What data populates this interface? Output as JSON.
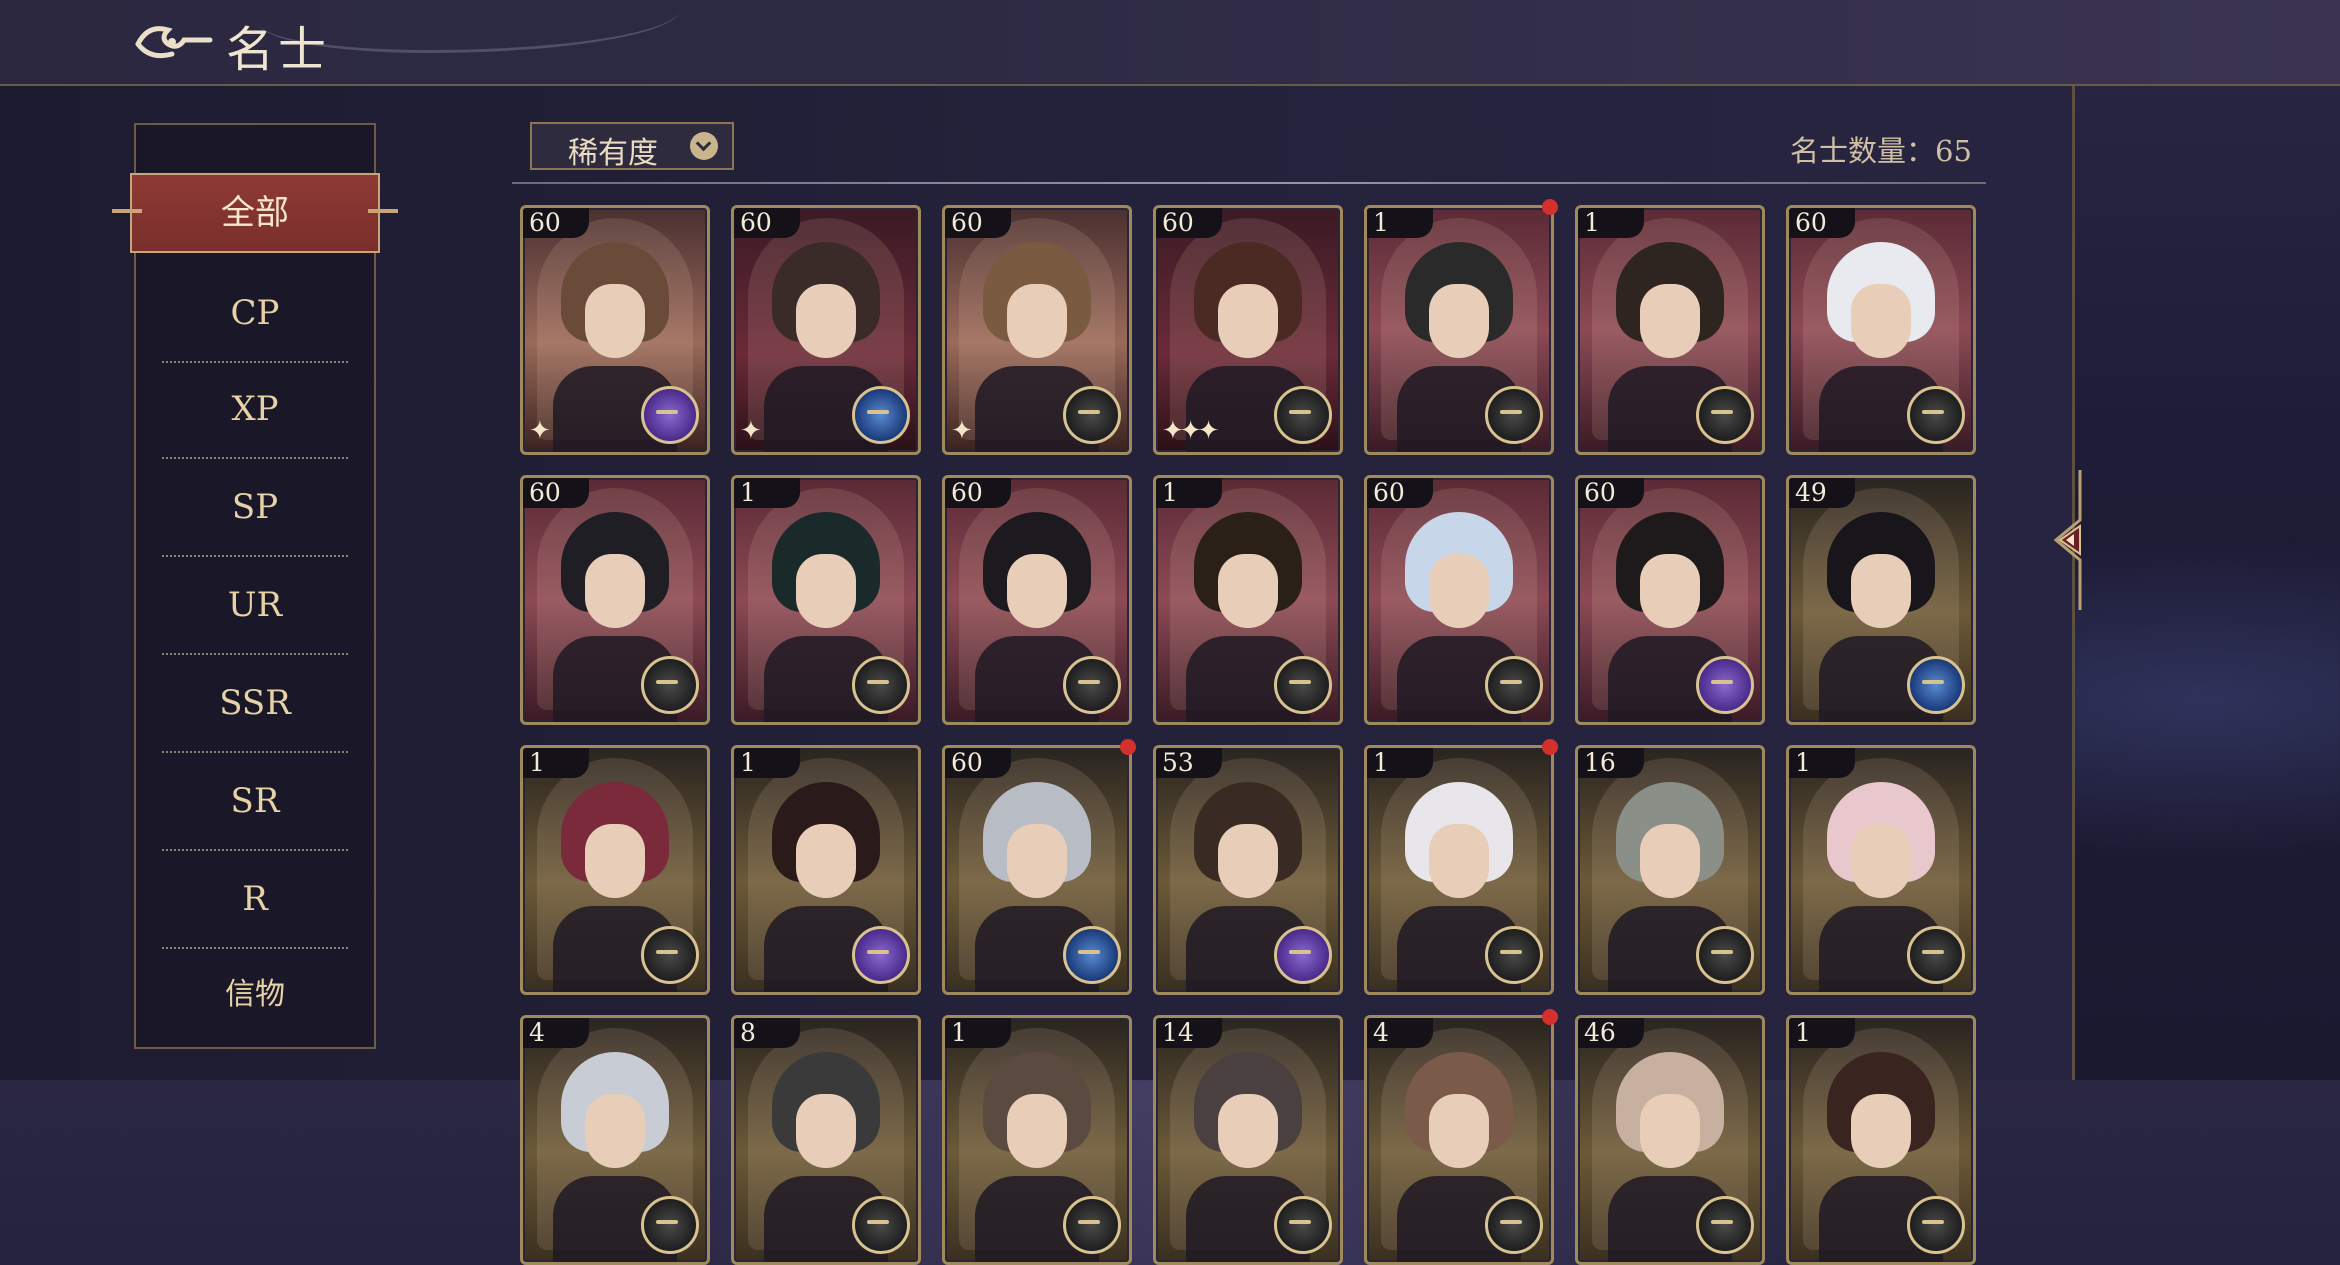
{
  "header": {
    "title": "名士"
  },
  "sidebar": {
    "active": "全部",
    "items": [
      "CP",
      "XP",
      "SP",
      "UR",
      "SSR",
      "SR",
      "R",
      "信物"
    ]
  },
  "toolbar": {
    "filter_label": "稀有度",
    "count_label": "名士数量：65"
  },
  "grid": {
    "rows": [
      [
        {
          "level": "60",
          "emblem": "purple",
          "bg": "rose",
          "dot": false,
          "sparkle": "✦"
        },
        {
          "level": "60",
          "emblem": "blue",
          "bg": "red",
          "dot": false,
          "sparkle": "✦"
        },
        {
          "level": "60",
          "emblem": "dark",
          "bg": "rose",
          "dot": false,
          "sparkle": "✦"
        },
        {
          "level": "60",
          "emblem": "dark",
          "bg": "red",
          "dot": false,
          "sparkle": "✦✦✦"
        },
        {
          "level": "1",
          "emblem": "dark",
          "bg": "pink",
          "dot": true,
          "sparkle": ""
        },
        {
          "level": "1",
          "emblem": "dark",
          "bg": "pink",
          "dot": false,
          "sparkle": ""
        },
        {
          "level": "60",
          "emblem": "dark",
          "bg": "pink",
          "dot": false,
          "sparkle": ""
        }
      ],
      [
        {
          "level": "60",
          "emblem": "dark",
          "bg": "pink",
          "dot": false,
          "sparkle": ""
        },
        {
          "level": "1",
          "emblem": "dark",
          "bg": "pink",
          "dot": false,
          "sparkle": ""
        },
        {
          "level": "60",
          "emblem": "dark",
          "bg": "pink",
          "dot": false,
          "sparkle": ""
        },
        {
          "level": "1",
          "emblem": "dark",
          "bg": "pink",
          "dot": false,
          "sparkle": ""
        },
        {
          "level": "60",
          "emblem": "dark",
          "bg": "pink",
          "dot": false,
          "sparkle": ""
        },
        {
          "level": "60",
          "emblem": "purple",
          "bg": "pink",
          "dot": false,
          "sparkle": ""
        },
        {
          "level": "49",
          "emblem": "blue",
          "bg": "gold",
          "dot": false,
          "sparkle": ""
        }
      ],
      [
        {
          "level": "1",
          "emblem": "dark",
          "bg": "gold",
          "dot": false,
          "sparkle": ""
        },
        {
          "level": "1",
          "emblem": "purple",
          "bg": "gold",
          "dot": false,
          "sparkle": ""
        },
        {
          "level": "60",
          "emblem": "blue",
          "bg": "gold",
          "dot": true,
          "sparkle": ""
        },
        {
          "level": "53",
          "emblem": "purple",
          "bg": "gold",
          "dot": false,
          "sparkle": ""
        },
        {
          "level": "1",
          "emblem": "dark",
          "bg": "gold",
          "dot": true,
          "sparkle": ""
        },
        {
          "level": "16",
          "emblem": "dark",
          "bg": "gold",
          "dot": false,
          "sparkle": ""
        },
        {
          "level": "1",
          "emblem": "dark",
          "bg": "gold",
          "dot": false,
          "sparkle": ""
        }
      ],
      [
        {
          "level": "4",
          "emblem": "dark",
          "bg": "gold",
          "dot": false,
          "sparkle": ""
        },
        {
          "level": "8",
          "emblem": "dark",
          "bg": "gold",
          "dot": false,
          "sparkle": ""
        },
        {
          "level": "1",
          "emblem": "dark",
          "bg": "gold",
          "dot": false,
          "sparkle": ""
        },
        {
          "level": "14",
          "emblem": "dark",
          "bg": "gold",
          "dot": false,
          "sparkle": ""
        },
        {
          "level": "4",
          "emblem": "dark",
          "bg": "gold",
          "dot": true,
          "sparkle": ""
        },
        {
          "level": "46",
          "emblem": "dark",
          "bg": "gold",
          "dot": false,
          "sparkle": ""
        },
        {
          "level": "1",
          "emblem": "dark",
          "bg": "gold",
          "dot": false,
          "sparkle": ""
        }
      ]
    ]
  },
  "colors": {
    "accent": "#8e3a34",
    "gold": "#c9a57a",
    "text": "#e6d2a6"
  }
}
